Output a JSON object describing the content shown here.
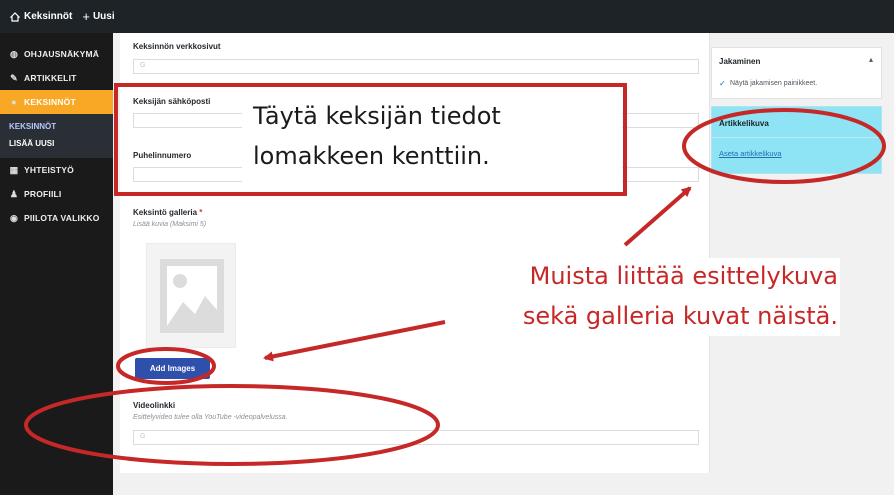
{
  "topbar": {
    "site_name": "Keksinnöt",
    "new_label": "Uusi"
  },
  "sidebar": {
    "items": [
      {
        "label": "OHJAUSNÄKYMÄ",
        "icon": "dashboard-icon"
      },
      {
        "label": "ARTIKKELIT",
        "icon": "pin-icon"
      },
      {
        "label": "KEKSINNÖT",
        "icon": "lightbulb-icon",
        "active": true
      },
      {
        "label": "YHTEISTYÖ",
        "icon": "grid-icon"
      },
      {
        "label": "PROFIILI",
        "icon": "user-icon"
      },
      {
        "label": "PIILOTA VALIKKO",
        "icon": "collapse-icon"
      }
    ],
    "submenu": [
      {
        "label": "KEKSINNÖT"
      },
      {
        "label": "LISÄÄ UUSI"
      }
    ]
  },
  "form": {
    "website_label": "Keksinnön verkkosivut",
    "email_label": "Keksijän sähköposti",
    "phone_label": "Puhelinnumero",
    "gallery_label": "Keksintö galleria",
    "gallery_required": "*",
    "gallery_desc": "Lisää kuvia (Maksimi 5)",
    "add_images_label": "Add Images",
    "video_label": "Videolinkki",
    "video_desc": "Esittelyvideo tulee olla YouTube -videopalvelussa.",
    "input_placeholder": "G"
  },
  "right": {
    "sharing_title": "Jakaminen",
    "sharing_option": "Näytä jakamisen painikkeet.",
    "featured_title": "Artikkelikuva",
    "featured_link": "Aseta artikkelikuva"
  },
  "annotations": {
    "box_text_line1": "Täytä keksijän tiedot",
    "box_text_line2": "lomakkeen kenttiin.",
    "reminder_line1": "Muista liittää esittelykuva",
    "reminder_line2": "sekä galleria kuvat näistä."
  },
  "colors": {
    "annotation_red": "#c62828",
    "active_nav": "#f9a825",
    "button_blue": "#2e4faa",
    "featured_panel": "#8ee3f5"
  }
}
